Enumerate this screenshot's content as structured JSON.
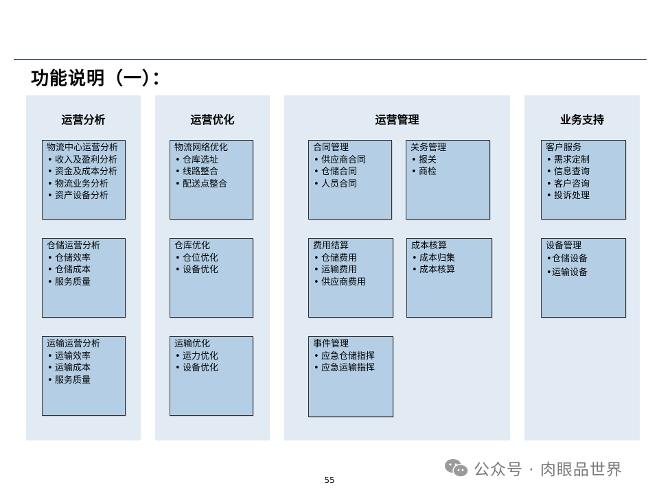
{
  "title": "功能说明（一）：",
  "columns": [
    {
      "title": "运营分析",
      "boxes": [
        {
          "title": "物流中心运营分析",
          "items": [
            "收入及盈利分析",
            "资金及成本分析",
            "物流业务分析",
            "资产设备分析"
          ]
        },
        {
          "title": "仓储运营分析",
          "items": [
            "仓储效率",
            "仓储成本",
            "服务质量"
          ]
        },
        {
          "title": "运输运营分析",
          "items": [
            "运输效率",
            "运输成本",
            "服务质量"
          ]
        }
      ]
    },
    {
      "title": "运营优化",
      "boxes": [
        {
          "title": "物流网络优化",
          "items": [
            "仓库选址",
            "线路整合",
            "配送点整合"
          ]
        },
        {
          "title": "仓库优化",
          "items": [
            "仓位优化",
            "设备优化"
          ]
        },
        {
          "title": "运输优化",
          "items": [
            "运力优化",
            "设备优化"
          ]
        }
      ]
    },
    {
      "title": "运营管理",
      "boxes": [
        {
          "title": "合同管理",
          "items": [
            "供应商合同",
            "仓储合同",
            "人员合同"
          ]
        },
        {
          "title": "关务管理",
          "items": [
            "报关",
            "商检"
          ]
        },
        {
          "title": "费用结算",
          "items": [
            "仓储费用",
            "运输费用",
            "供应商费用"
          ]
        },
        {
          "title": "成本核算",
          "items": [
            "成本归集",
            "成本核算"
          ]
        },
        {
          "title": "事件管理",
          "items": [
            "应急仓储指挥",
            "应急运输指挥"
          ]
        }
      ]
    },
    {
      "title": "业务支持",
      "boxes": [
        {
          "title": "客户服务",
          "items": [
            "需求定制",
            "信息查询",
            "客户咨询",
            "投诉处理"
          ]
        },
        {
          "title": "设备管理",
          "items": [
            "仓储设备",
            "运输设备"
          ]
        }
      ]
    }
  ],
  "page_number": "55",
  "watermark": "公众号 · 肉眼品世界"
}
